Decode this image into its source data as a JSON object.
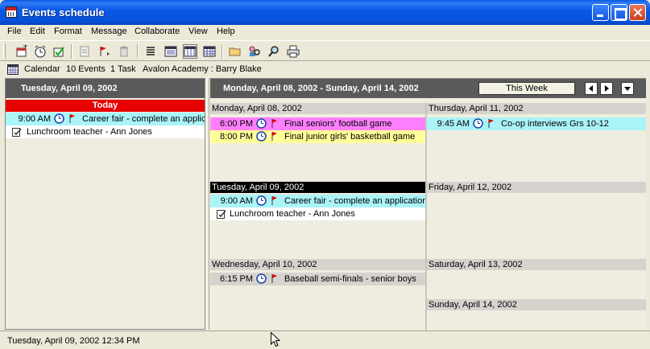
{
  "window": {
    "title": "Events schedule"
  },
  "menu": [
    "File",
    "Edit",
    "Format",
    "Message",
    "Collaborate",
    "View",
    "Help"
  ],
  "toolbar": {
    "tools": [
      "new-event-icon",
      "new-alarm-icon",
      "new-task-icon",
      "copy-icon",
      "send-flag-icon",
      "delete-icon",
      "list-view-icon",
      "day-view-icon",
      "week-view-icon",
      "month-view-icon",
      "folder-icon",
      "people-search-icon",
      "find-icon",
      "print-icon"
    ]
  },
  "infobar": {
    "view_name": "Calendar",
    "counts": "10 Events  1 Task",
    "owner": "Avalon Academy : Barry Blake"
  },
  "left": {
    "date_header": "Tuesday, April 09, 2002",
    "today_label": "Today",
    "events": [
      {
        "time": "9:00 AM",
        "title": "Career fair - complete an application",
        "color": "#aaf4f8"
      }
    ],
    "tasks": [
      {
        "title": "Lunchroom teacher - Ann Jones"
      }
    ]
  },
  "week": {
    "range": "Monday, April 08, 2002 - Sunday, April 14, 2002",
    "this_week_label": "This Week",
    "days": {
      "mon": {
        "label": "Monday, April 08, 2002",
        "events": [
          {
            "time": "6:00 PM",
            "title": "Final seniors' football game",
            "color": "#ff80ff"
          },
          {
            "time": "8:00 PM",
            "title": "Final junior girls' basketball game",
            "color": "#ffff99"
          }
        ]
      },
      "tue": {
        "label": "Tuesday, April 09, 2002",
        "events": [
          {
            "time": "9:00 AM",
            "title": "Career fair - complete an application",
            "color": "#aaf4f8"
          }
        ],
        "tasks": [
          {
            "title": "Lunchroom teacher - Ann Jones"
          }
        ]
      },
      "wed": {
        "label": "Wednesday, April 10, 2002",
        "events": [
          {
            "time": "6:15 PM",
            "title": "Baseball semi-finals - senior boys",
            "color": "#d6d3ce"
          }
        ]
      },
      "thu": {
        "label": "Thursday, April 11, 2002",
        "events": [
          {
            "time": "9:45 AM",
            "title": "Co-op interviews Grs 10-12",
            "color": "#aaf4f8"
          }
        ]
      },
      "fri": {
        "label": "Friday, April 12, 2002"
      },
      "sat": {
        "label": "Saturday, April 13, 2002"
      },
      "sun": {
        "label": "Sunday, April 14, 2002"
      }
    }
  },
  "status": {
    "datetime": "Tuesday, April 09, 2002 12:34 PM"
  },
  "colors": {
    "today": "#e60000",
    "header": "#5a5a5a",
    "titlebar": "#0651d9"
  }
}
